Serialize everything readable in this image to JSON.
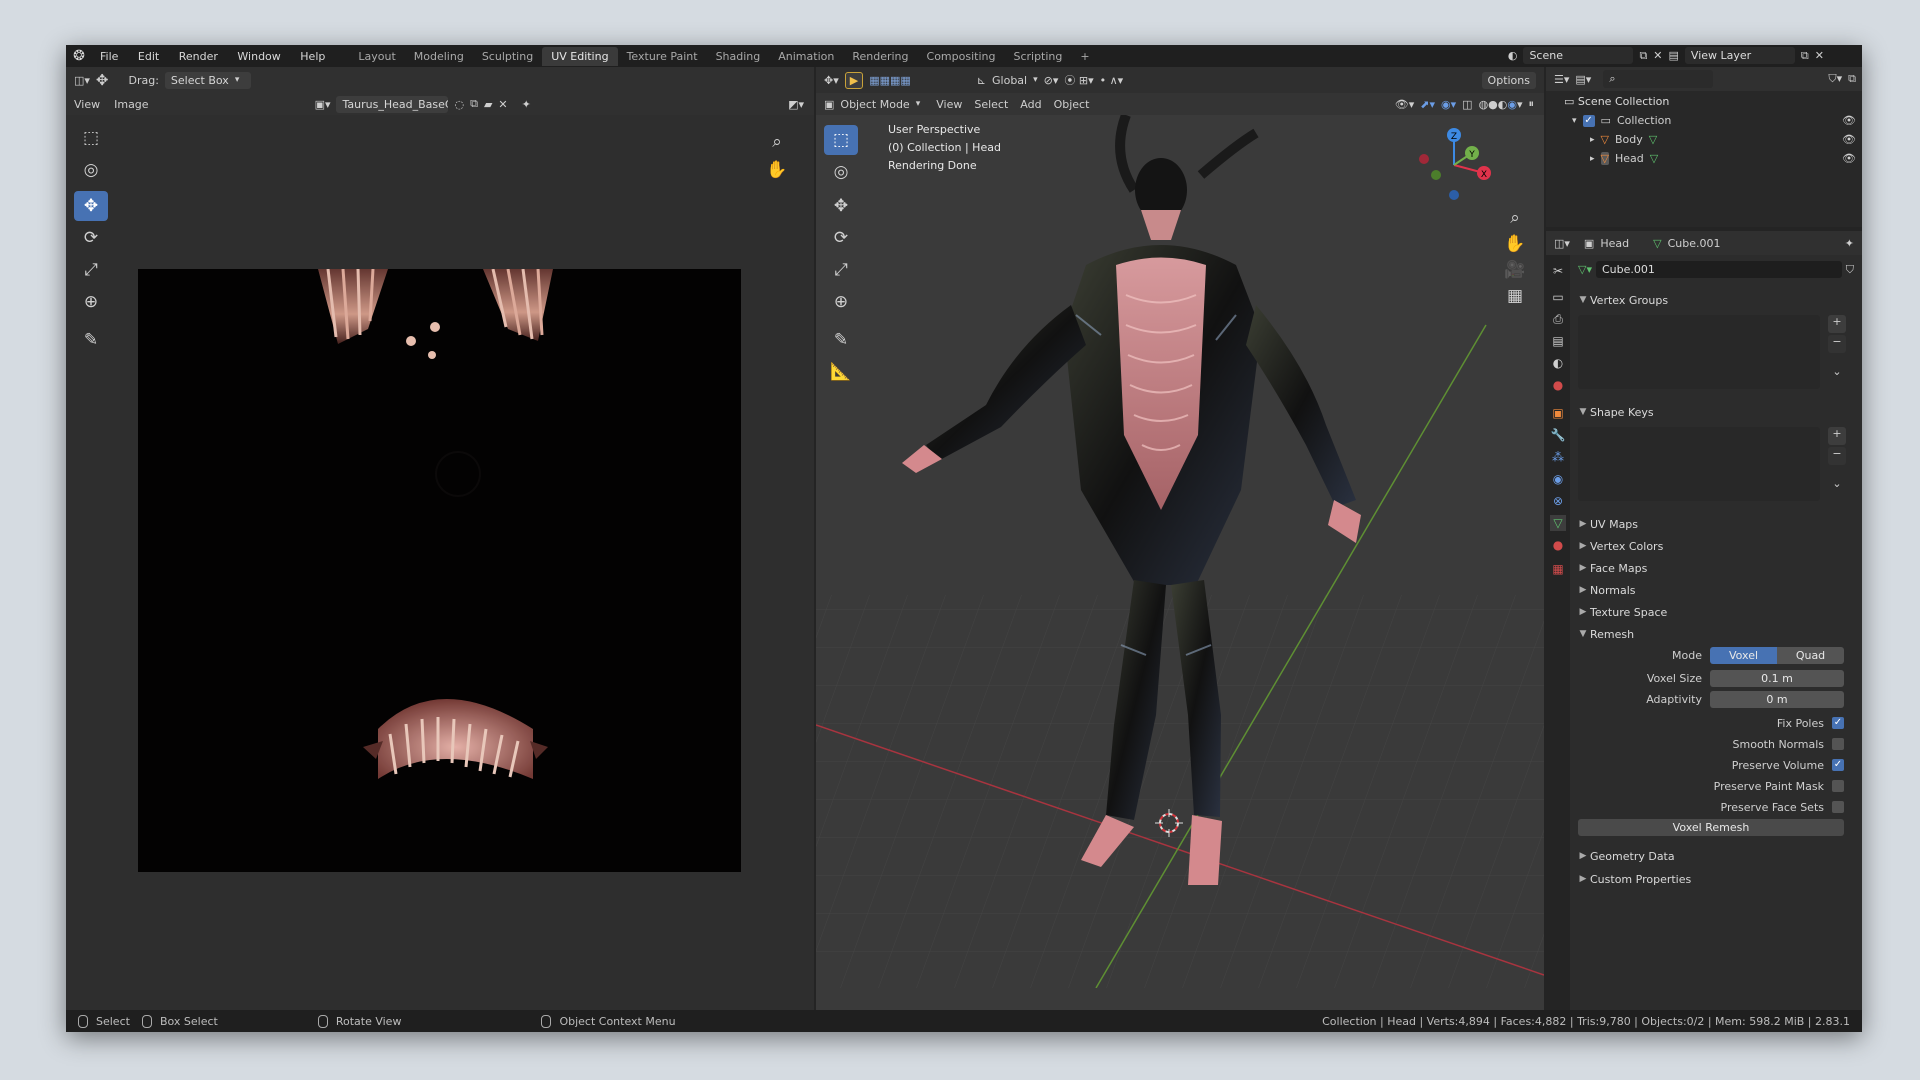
{
  "topbar": {
    "menus": [
      "File",
      "Edit",
      "Render",
      "Window",
      "Help"
    ],
    "workspaces": [
      "Layout",
      "Modeling",
      "Sculpting",
      "UV Editing",
      "Texture Paint",
      "Shading",
      "Animation",
      "Rendering",
      "Compositing",
      "Scripting"
    ],
    "active_workspace": "UV Editing",
    "add_tab": "+",
    "scene": "Scene",
    "view_layer": "View Layer"
  },
  "uv_editor": {
    "drag_label": "Drag:",
    "drag_value": "Select Box",
    "menu_view": "View",
    "menu_image": "Image",
    "image_name": "Taurus_Head_BaseC..."
  },
  "viewport": {
    "mode": "Object Mode",
    "menus": [
      "View",
      "Select",
      "Add",
      "Object"
    ],
    "orientation": "Global",
    "options": "Options",
    "overlay_lines": [
      "User Perspective",
      "(0) Collection | Head",
      "Rendering Done"
    ],
    "gizmo_axes": {
      "x": "X",
      "y": "Y",
      "z": "Z"
    }
  },
  "outliner": {
    "scene_collection": "Scene Collection",
    "items": [
      {
        "name": "Collection",
        "indent": 1
      },
      {
        "name": "Body",
        "indent": 2
      },
      {
        "name": "Head",
        "indent": 2
      }
    ]
  },
  "properties": {
    "object_name": "Head",
    "mesh_name": "Cube.001",
    "mesh_field": "Cube.001",
    "panels_open_top": [
      "Vertex Groups",
      "Shape Keys"
    ],
    "closed_panels": [
      "UV Maps",
      "Vertex Colors",
      "Face Maps",
      "Normals",
      "Texture Space"
    ],
    "remesh": {
      "title": "Remesh",
      "mode_label": "Mode",
      "mode_options": [
        "Voxel",
        "Quad"
      ],
      "mode_selected": "Voxel",
      "voxel_size_label": "Voxel Size",
      "voxel_size": "0.1 m",
      "adaptivity_label": "Adaptivity",
      "adaptivity": "0 m",
      "checks": [
        {
          "label": "Fix Poles",
          "checked": true
        },
        {
          "label": "Smooth Normals",
          "checked": false
        },
        {
          "label": "Preserve Volume",
          "checked": true
        },
        {
          "label": "Preserve Paint Mask",
          "checked": false
        },
        {
          "label": "Preserve Face Sets",
          "checked": false
        }
      ],
      "button": "Voxel Remesh"
    },
    "bottom_panels": [
      "Geometry Data",
      "Custom Properties"
    ]
  },
  "statusbar": {
    "select": "Select",
    "box_select": "Box Select",
    "rotate_view": "Rotate View",
    "context_menu": "Object Context Menu",
    "stats": "Collection | Head | Verts:4,894 | Faces:4,882 | Tris:9,780 | Objects:0/2 | Mem: 598.2 MiB | 2.83.1"
  },
  "colors": {
    "accent": "#4772b3",
    "axis_x": "#e0334b",
    "axis_y": "#72b04a",
    "axis_z": "#3d8ae4"
  }
}
